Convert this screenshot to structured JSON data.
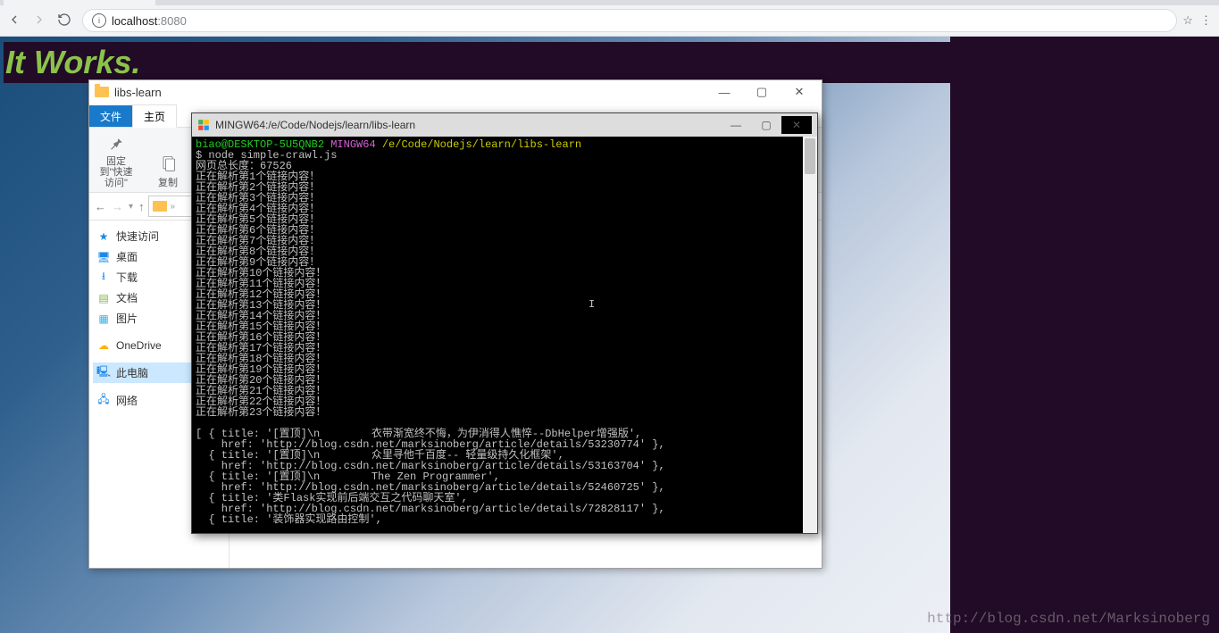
{
  "browser": {
    "url_host": "localhost",
    "url_port": ":8080"
  },
  "page": {
    "headline": "It Works.",
    "watermark": "http://blog.csdn.net/Marksinoberg"
  },
  "explorer": {
    "title": "libs-learn",
    "ribbon": {
      "file": "文件",
      "home": "主页"
    },
    "toolbar": {
      "pin": "固定到\"快速访问\"",
      "copy": "复制"
    },
    "path": "»",
    "nav": {
      "back": "←",
      "forward": "→",
      "up": "↑",
      "refresh": "⟳",
      "items": [
        {
          "label": "快速访问",
          "icon": "star",
          "accent": "#1e88e5"
        },
        {
          "label": "桌面",
          "icon": "desktop",
          "accent": "#1e88e5"
        },
        {
          "label": "下载",
          "icon": "download",
          "accent": "#1e88e5"
        },
        {
          "label": "文档",
          "icon": "doc",
          "accent": "#7cb342"
        },
        {
          "label": "图片",
          "icon": "pic",
          "accent": "#29b6f6"
        }
      ],
      "onedrive": "OneDrive",
      "thispc": "此电脑",
      "network": "网络"
    }
  },
  "terminal": {
    "title": "MINGW64:/e/Code/Nodejs/learn/libs-learn",
    "prompt_user": "biao@DESKTOP-5U5QNB2",
    "prompt_env": "MINGW64",
    "prompt_path": "/e/Code/Nodejs/learn/libs-learn",
    "command": "$ node simple-crawl.js",
    "len_line": "网页总长度：67526",
    "parse_lines": [
      "正在解析第1个链接内容！",
      "正在解析第2个链接内容！",
      "正在解析第3个链接内容！",
      "正在解析第4个链接内容！",
      "正在解析第5个链接内容！",
      "正在解析第6个链接内容！",
      "正在解析第7个链接内容！",
      "正在解析第8个链接内容！",
      "正在解析第9个链接内容！",
      "正在解析第10个链接内容！",
      "正在解析第11个链接内容！",
      "正在解析第12个链接内容！",
      "正在解析第13个链接内容！",
      "正在解析第14个链接内容！",
      "正在解析第15个链接内容！",
      "正在解析第16个链接内容！",
      "正在解析第17个链接内容！",
      "正在解析第18个链接内容！",
      "正在解析第19个链接内容！",
      "正在解析第20个链接内容！",
      "正在解析第21个链接内容！",
      "正在解析第22个链接内容！",
      "正在解析第23个链接内容！"
    ],
    "objects": [
      "[ { title: '[置顶]\\n        衣带渐宽终不悔，为伊消得人憔悴--DbHelper增强版',",
      "    href: 'http://blog.csdn.net/marksinoberg/article/details/53230774' },",
      "  { title: '[置顶]\\n        众里寻他千百度-- 轻量级持久化框架',",
      "    href: 'http://blog.csdn.net/marksinoberg/article/details/53163704' },",
      "  { title: '[置顶]\\n        The Zen Programmer',",
      "    href: 'http://blog.csdn.net/marksinoberg/article/details/52460725' },",
      "  { title: '类Flask实现前后端交互之代码聊天室',",
      "    href: 'http://blog.csdn.net/marksinoberg/article/details/72828117' },",
      "  { title: '装饰器实现路由控制',"
    ]
  }
}
